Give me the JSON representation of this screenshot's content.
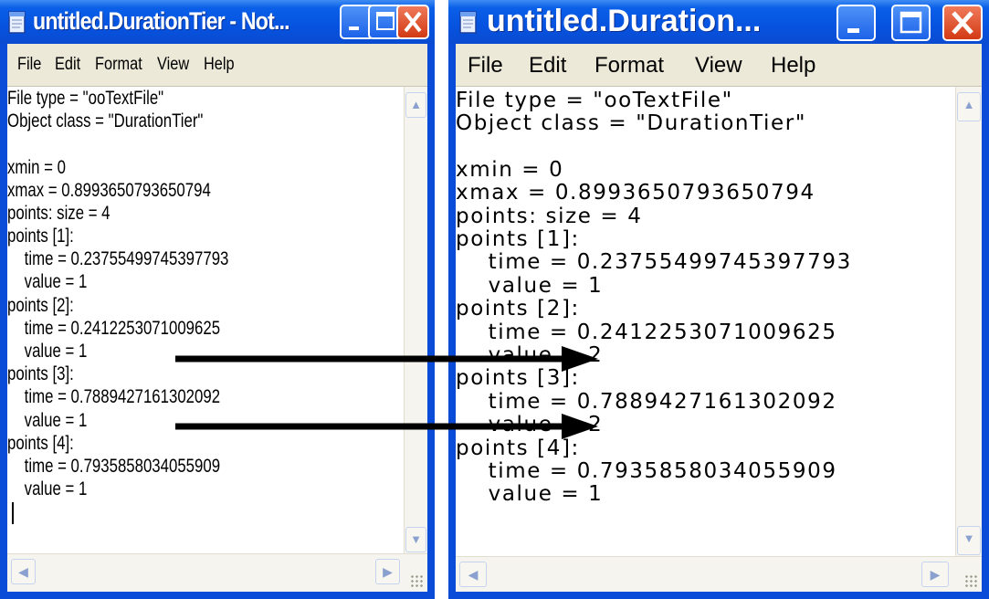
{
  "left_window": {
    "title": "untitled.DurationTier - Not...",
    "menu": [
      "File",
      "Edit",
      "Format",
      "View",
      "Help"
    ],
    "lines": [
      "File type = \"ooTextFile\"",
      "Object class = \"DurationTier\"",
      "",
      "xmin = 0",
      "xmax = 0.8993650793650794",
      "points: size = 4",
      "points [1]:",
      "    time = 0.23755499745397793",
      "    value = 1",
      "points [2]:",
      "    time = 0.2412253071009625",
      "    value = 1",
      "points [3]:",
      "    time = 0.7889427161302092",
      "    value = 1",
      "points [4]:",
      "    time = 0.7935858034055909",
      "    value = 1"
    ]
  },
  "right_window": {
    "title": "untitled.Duration...",
    "menu": [
      "File",
      "Edit",
      "Format",
      "View",
      "Help"
    ],
    "lines": [
      "File type = \"ooTextFile\"",
      "Object class = \"DurationTier\"",
      "",
      "xmin = 0",
      "xmax = 0.8993650793650794",
      "points: size = 4",
      "points [1]:",
      "    time = 0.23755499745397793",
      "    value = 1",
      "points [2]:",
      "    time = 0.2412253071009625",
      "    value = 2",
      "points [3]:",
      "    time = 0.7889427161302092",
      "    value = 2",
      "points [4]:",
      "    time = 0.7935858034055909",
      "    value = 1"
    ]
  },
  "colors": {
    "xp_blue": "#0a4bd8",
    "menu_bg": "#ece9d8",
    "close_red": "#d23a14",
    "arrow": "#000000"
  },
  "icons": [
    "notepad-icon",
    "minimize-icon",
    "maximize-icon",
    "close-icon",
    "scroll-up-icon",
    "scroll-down-icon",
    "scroll-left-icon",
    "scroll-right-icon",
    "resize-grip-icon"
  ]
}
